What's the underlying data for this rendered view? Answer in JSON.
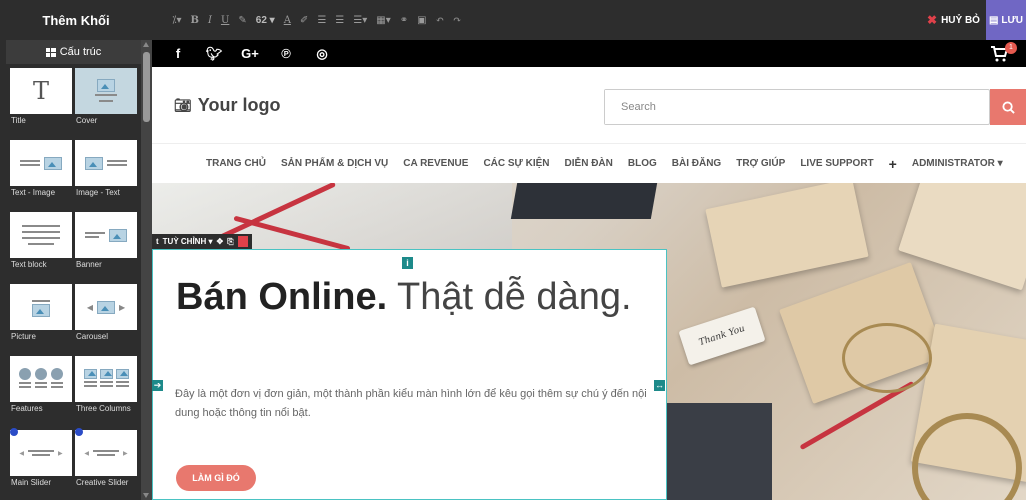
{
  "left_panel": {
    "title": "Thêm Khối",
    "section": "Cấu trúc",
    "blocks": [
      {
        "label": "Title"
      },
      {
        "label": "Cover"
      },
      {
        "label": "Text - Image"
      },
      {
        "label": "Image - Text"
      },
      {
        "label": "Text block"
      },
      {
        "label": "Banner"
      },
      {
        "label": "Picture"
      },
      {
        "label": "Carousel"
      },
      {
        "label": "Features"
      },
      {
        "label": "Three Columns"
      },
      {
        "label": "Main Slider"
      },
      {
        "label": "Creative Slider"
      }
    ]
  },
  "toolbar": {
    "font_size": "62",
    "cancel_label": "HUỶ BỎ",
    "save_label": "LƯU"
  },
  "social": {
    "icons": [
      "facebook-icon",
      "twitter-icon",
      "google-plus-icon",
      "pinterest-icon",
      "instagram-icon"
    ],
    "cart_count": "1"
  },
  "header": {
    "logo": "Your logo",
    "search_placeholder": "Search"
  },
  "nav": {
    "items": [
      "TRANG CHỦ",
      "SẢN PHẨM & DỊCH VỤ",
      "CA REVENUE",
      "CÁC SỰ KIỆN",
      "DIỄN ĐÀN",
      "BLOG",
      "BÀI ĐĂNG",
      "TRỢ GIÚP",
      "LIVE SUPPORT"
    ],
    "plus": "+",
    "user": "ADMINISTRATOR"
  },
  "hero": {
    "block_tool_label": "TUỲ CHỈNH",
    "title_bold": "Bán Online.",
    "title_light": "Thật dễ dàng.",
    "description": "Đây là một đơn vị đơn giản, một thành phần kiểu màn hình lớn để kêu gọi thêm sự chú ý đến nội dung hoặc thông tin nổi bật.",
    "button": "LÀM GÌ ĐÓ",
    "tag_text": "Thank You"
  },
  "colors": {
    "accent": "#e8786e",
    "save": "#7067c4",
    "cancel_x": "#e0414a",
    "selection": "#4ac3c3"
  }
}
